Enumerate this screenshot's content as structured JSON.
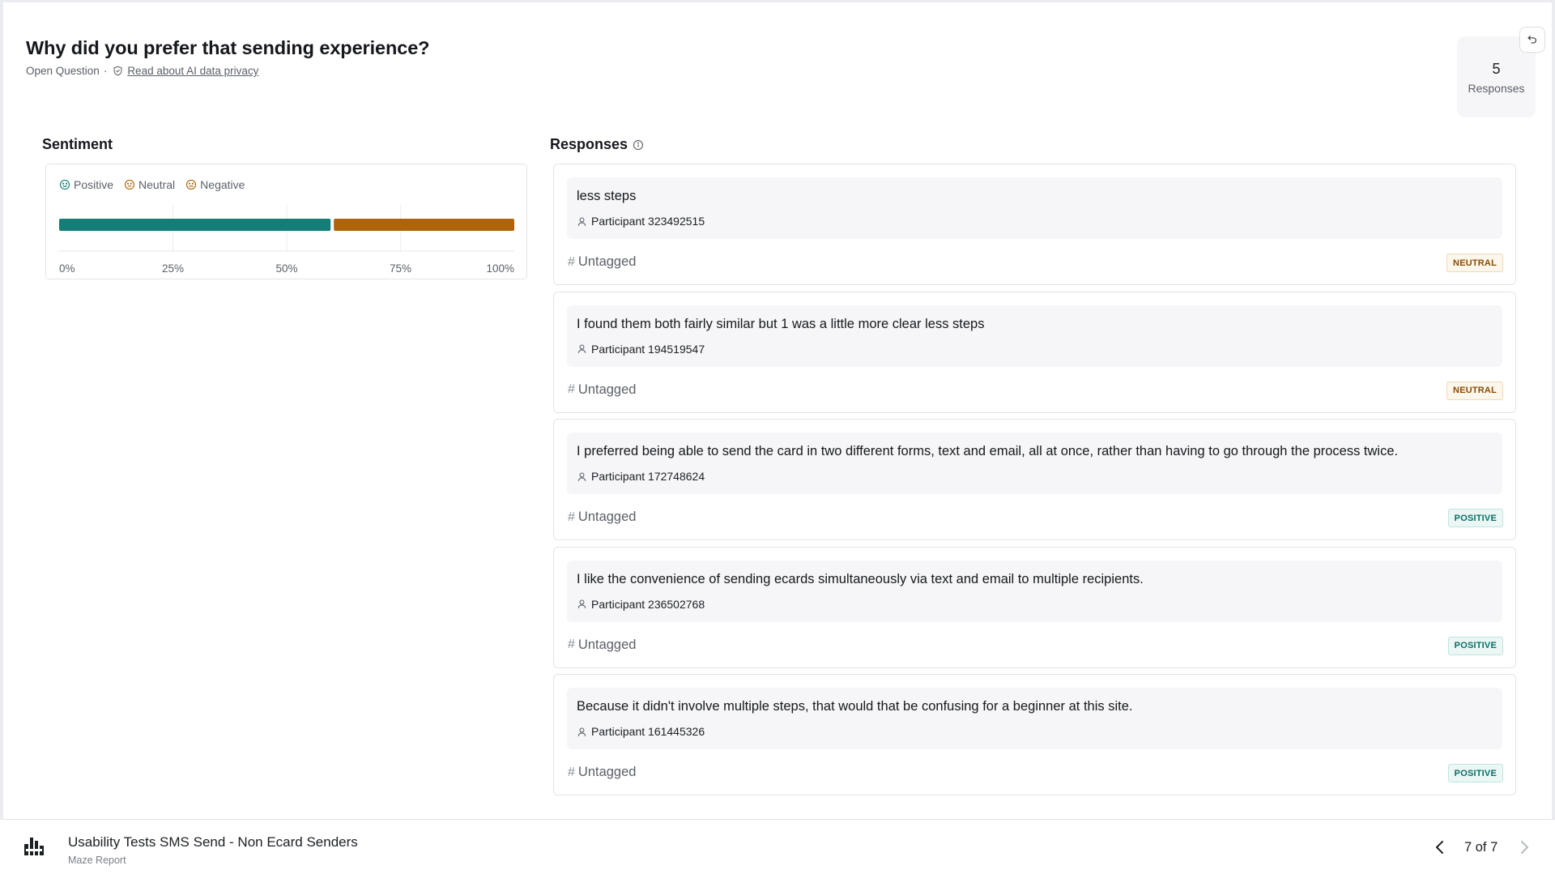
{
  "question": {
    "title": "Why did you prefer that sending experience?",
    "type": "Open Question",
    "separator": "·",
    "privacy_link": "Read about AI data privacy"
  },
  "summary": {
    "count": "5",
    "label": "Responses"
  },
  "sentiment": {
    "title": "Sentiment",
    "legend": [
      {
        "label": "Positive",
        "icon": "smile-icon",
        "color": "#137e76"
      },
      {
        "label": "Neutral",
        "icon": "neutral-face-icon",
        "color": "#b0640a"
      },
      {
        "label": "Negative",
        "icon": "frown-icon",
        "color": "#b0640a"
      }
    ]
  },
  "chart_data": {
    "type": "bar",
    "orientation": "horizontal-stacked",
    "series": [
      {
        "name": "Positive",
        "values": [
          60
        ],
        "color": "#137e76"
      },
      {
        "name": "Neutral",
        "values": [
          40
        ],
        "color": "#b0640a"
      }
    ],
    "xlim": [
      0,
      100
    ],
    "xticks": [
      "0%",
      "25%",
      "50%",
      "75%",
      "100%"
    ],
    "grid": true
  },
  "responses_section": {
    "title": "Responses",
    "icon": "info-icon"
  },
  "responses": [
    {
      "text": "less steps",
      "participant": "Participant 323492515",
      "tag": "Untagged",
      "sentiment": "NEUTRAL"
    },
    {
      "text": "I found them both fairly similar but 1 was a little more clear less steps",
      "participant": "Participant 194519547",
      "tag": "Untagged",
      "sentiment": "NEUTRAL"
    },
    {
      "text": "I preferred being able to send the card in two different forms, text and email, all at once, rather than having to go through the process twice.",
      "participant": "Participant 172748624",
      "tag": "Untagged",
      "sentiment": "POSITIVE"
    },
    {
      "text": "I like the convenience of sending ecards simultaneously via text and email to multiple recipients.",
      "participant": "Participant 236502768",
      "tag": "Untagged",
      "sentiment": "POSITIVE"
    },
    {
      "text": "Because it didn't involve multiple steps, that would that be confusing for a beginner at this site.",
      "participant": "Participant 161445326",
      "tag": "Untagged",
      "sentiment": "POSITIVE"
    }
  ],
  "footer": {
    "title": "Usability Tests SMS Send - Non Ecard Senders",
    "subtitle": "Maze Report",
    "pagination": "7 of 7"
  }
}
